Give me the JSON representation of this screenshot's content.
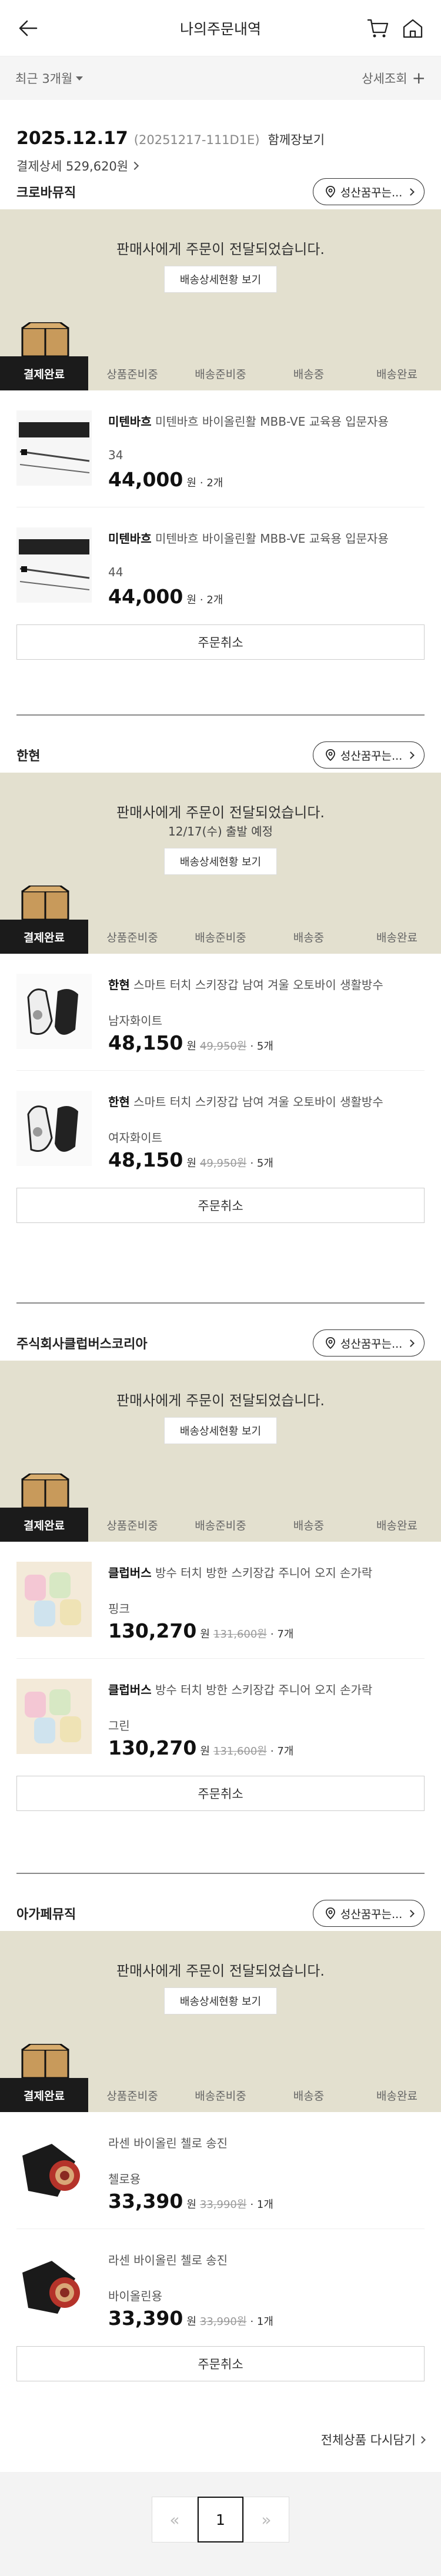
{
  "header": {
    "title": "나의주문내역",
    "back_icon": "back-arrow-icon",
    "cart_icon": "cart-icon",
    "home_icon": "home-icon"
  },
  "filter": {
    "period": "최근 3개월",
    "detail": "상세조회"
  },
  "order": {
    "date": "2025.12.17",
    "number": "(20251217-111D1E)",
    "view_all": "함께장보기",
    "pay_label": "결제상세 529,620원"
  },
  "status_steps": [
    "결제완료",
    "상품준비중",
    "배송준비중",
    "배송중",
    "배송완료"
  ],
  "track_label": "배송상세현황 보기",
  "cancel_label": "주문취소",
  "loc_label": "성산꿈꾸는...",
  "sellers": [
    {
      "name": "크로바뮤직",
      "msg": "판매사에게 주문이 전달되었습니다.",
      "msg2": "",
      "products": [
        {
          "brand": "미텐바흐",
          "desc": "미텐바흐 바이올린활 MBB-VE 교육용 입문자용",
          "option": "34",
          "price": "44,000",
          "won": "원",
          "orig": "",
          "qty": "· 2개"
        },
        {
          "brand": "미텐바흐",
          "desc": "미텐바흐 바이올린활 MBB-VE 교육용 입문자용",
          "option": "44",
          "price": "44,000",
          "won": "원",
          "orig": "",
          "qty": "· 2개"
        }
      ]
    },
    {
      "name": "한현",
      "msg": "판매사에게 주문이 전달되었습니다.",
      "msg2": "12/17(수) 출발 예정",
      "products": [
        {
          "brand": "한현",
          "desc": "스마트 터치 스키장갑 남여 겨울 오토바이 생활방수",
          "option": "남자화이트",
          "price": "48,150",
          "won": "원",
          "orig": "49,950원",
          "qty": "· 5개"
        },
        {
          "brand": "한현",
          "desc": "스마트 터치 스키장갑 남여 겨울 오토바이 생활방수",
          "option": "여자화이트",
          "price": "48,150",
          "won": "원",
          "orig": "49,950원",
          "qty": "· 5개"
        }
      ]
    },
    {
      "name": "주식회사클럽버스코리아",
      "msg": "판매사에게 주문이 전달되었습니다.",
      "msg2": "",
      "products": [
        {
          "brand": "클럽버스",
          "desc": "방수 터치 방한 스키장갑 주니어 오지 손가락",
          "option": "핑크",
          "price": "130,270",
          "won": "원",
          "orig": "131,600원",
          "qty": "· 7개"
        },
        {
          "brand": "클럽버스",
          "desc": "방수 터치 방한 스키장갑 주니어 오지 손가락",
          "option": "그린",
          "price": "130,270",
          "won": "원",
          "orig": "131,600원",
          "qty": "· 7개"
        }
      ]
    },
    {
      "name": "아가페뮤직",
      "msg": "판매사에게 주문이 전달되었습니다.",
      "msg2": "",
      "products": [
        {
          "brand": "",
          "desc": "라센 바이올린 첼로 송진",
          "option": "첼로용",
          "price": "33,390",
          "won": "원",
          "orig": "33,990원",
          "qty": "· 1개"
        },
        {
          "brand": "",
          "desc": "라센 바이올린 첼로 송진",
          "option": "바이올린용",
          "price": "33,390",
          "won": "원",
          "orig": "33,990원",
          "qty": "· 1개"
        }
      ]
    }
  ],
  "repurchase": "전체상품 다시담기",
  "pager": {
    "prev": "«",
    "current": "1",
    "next": "»"
  },
  "colors": {
    "status_bg": "#e3e0cf",
    "active_step": "#1b1b1b"
  }
}
